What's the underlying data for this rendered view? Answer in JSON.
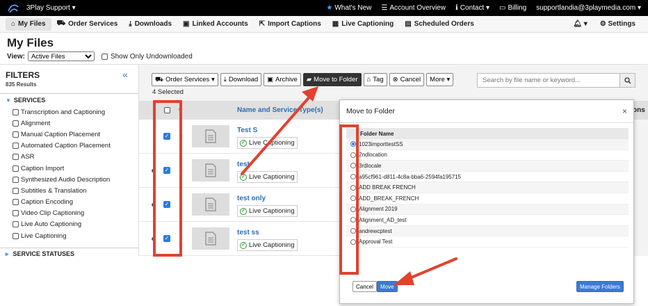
{
  "topbar": {
    "brand": "3Play Support ▾",
    "links": [
      "What's New",
      "Account Overview",
      "Contact ▾",
      "Billing",
      "supportlandia@3playmedia.com ▾"
    ]
  },
  "nav": {
    "tabs": [
      "My Files",
      "Order Services",
      "Downloads",
      "Linked Accounts",
      "Import Captions",
      "Live Captioning",
      "Scheduled Orders"
    ],
    "settings": "Settings"
  },
  "page": {
    "title": "My Files",
    "view_label": "View:",
    "view_value": "Active Files",
    "show_undownloaded": "Show Only Undownloaded"
  },
  "filters": {
    "title": "FILTERS",
    "count": "835 Results",
    "services_label": "SERVICES",
    "services": [
      "Transcription and Captioning",
      "Alignment",
      "Manual Caption Placement",
      "Automated Caption Placement",
      "ASR",
      "Caption Import",
      "Synthesized Audio Description",
      "Subtitles & Translation",
      "Caption Encoding",
      "Video Clip Captioning",
      "Live Auto Captioning",
      "Live Captioning"
    ],
    "statuses_label": "SERVICE STATUSES"
  },
  "toolbar": {
    "order_services": "Order Services ▾",
    "download": "Download",
    "archive": "Archive",
    "move_to_folder": "Move to Folder",
    "tag": "Tag",
    "cancel": "Cancel",
    "more": "More ▾",
    "selected": "4 Selected",
    "search_placeholder": "Search by file name or keyword..."
  },
  "table": {
    "header_name": "Name and Service Type(s)",
    "header_right": "ons",
    "rows": [
      {
        "name": "Test S",
        "service": "Live Captioning"
      },
      {
        "name": "test",
        "service": "Live Captioning"
      },
      {
        "name": "test only",
        "service": "Live Captioning"
      },
      {
        "name": "test ss",
        "service": "Live Captioning"
      }
    ]
  },
  "modal": {
    "title": "Move to Folder",
    "close": "×",
    "column": "Folder Name",
    "folders": [
      "1023importtestSS",
      "2ndlocation",
      "3rdlocale",
      "a95cf961-d811-4c8a-bba6-2594fa195715",
      "ADD BREAK FRENCH",
      "ADD_BREAK_FRENCH",
      "Alignment 2019",
      "Alignment_AD_test",
      "andrewcptest",
      "Approval Test"
    ],
    "selected_index": 0,
    "cancel": "Cancel",
    "move": "Move",
    "manage": "Manage Folders"
  },
  "colors": {
    "annotation": "#e2412f",
    "primary": "#3a7bd5",
    "link": "#2a6fb5"
  }
}
